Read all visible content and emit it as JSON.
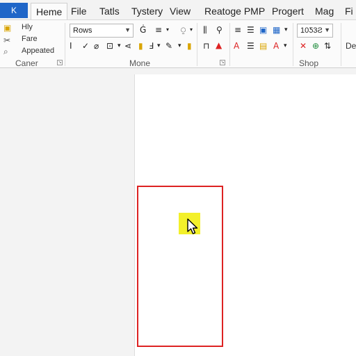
{
  "app": {
    "button_label": "K"
  },
  "tabs": [
    "Heme",
    "File",
    "Tatls",
    "Tystery",
    "View",
    "Reatoge PMP",
    "Progert",
    "Mag",
    "Fi"
  ],
  "clipboard": {
    "items": [
      "Hly",
      "Fare",
      "Appeated"
    ],
    "group_label": "Caner"
  },
  "font": {
    "style_value": "Rows",
    "group_label": "Mone"
  },
  "number": {
    "value": "10Ƽ3Ƨ",
    "group_label": "Shop"
  },
  "extra": {
    "label": "De"
  },
  "colors": {
    "accent": "#1f66c8",
    "highlight": "#f3f02a",
    "selection": "#d22222"
  }
}
